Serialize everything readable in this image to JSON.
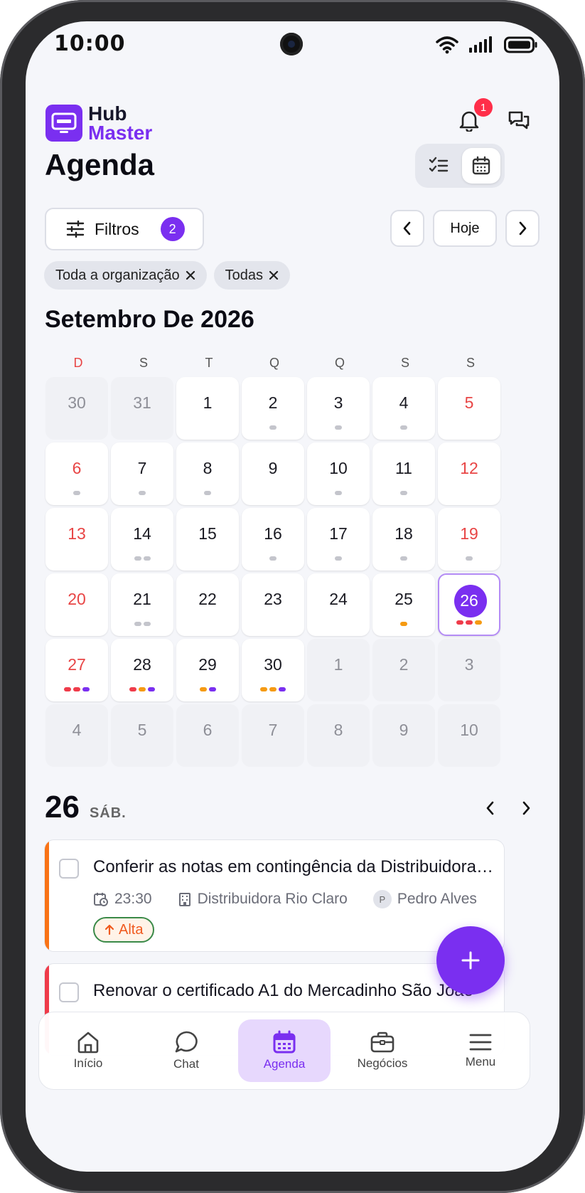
{
  "status_bar": {
    "time": "10:00"
  },
  "app": {
    "logo_line1": "Hub",
    "logo_line2": "Master",
    "notifications_count": "1"
  },
  "page": {
    "title": "Agenda"
  },
  "filters": {
    "label": "Filtros",
    "count": "2",
    "today": "Hoje"
  },
  "chips": [
    {
      "label": "Toda a organização"
    },
    {
      "label": "Todas"
    }
  ],
  "calendar": {
    "month_title": "Setembro De 2026",
    "weekdays": [
      "D",
      "S",
      "T",
      "Q",
      "Q",
      "S",
      "S"
    ],
    "colors": {
      "gray": "#c4c5cc",
      "red": "#ef3b4a",
      "orange": "#f59a12",
      "purple": "#7a2ff0"
    },
    "days": [
      {
        "n": "30",
        "out": true,
        "dots": []
      },
      {
        "n": "31",
        "out": true,
        "dots": []
      },
      {
        "n": "1",
        "dots": []
      },
      {
        "n": "2",
        "dots": [
          "gray"
        ]
      },
      {
        "n": "3",
        "dots": [
          "gray"
        ]
      },
      {
        "n": "4",
        "dots": [
          "gray"
        ]
      },
      {
        "n": "5",
        "weekend": true,
        "dots": []
      },
      {
        "n": "6",
        "weekend": true,
        "dots": [
          "gray"
        ]
      },
      {
        "n": "7",
        "dots": [
          "gray"
        ]
      },
      {
        "n": "8",
        "dots": [
          "gray"
        ]
      },
      {
        "n": "9",
        "dots": []
      },
      {
        "n": "10",
        "dots": [
          "gray"
        ]
      },
      {
        "n": "11",
        "dots": [
          "gray"
        ]
      },
      {
        "n": "12",
        "weekend": true,
        "dots": []
      },
      {
        "n": "13",
        "weekend": true,
        "dots": []
      },
      {
        "n": "14",
        "dots": [
          "gray",
          "gray"
        ]
      },
      {
        "n": "15",
        "dots": []
      },
      {
        "n": "16",
        "dots": [
          "gray"
        ]
      },
      {
        "n": "17",
        "dots": [
          "gray"
        ]
      },
      {
        "n": "18",
        "dots": [
          "gray"
        ]
      },
      {
        "n": "19",
        "weekend": true,
        "dots": [
          "gray"
        ]
      },
      {
        "n": "20",
        "weekend": true,
        "dots": []
      },
      {
        "n": "21",
        "dots": [
          "gray",
          "gray"
        ]
      },
      {
        "n": "22",
        "dots": []
      },
      {
        "n": "23",
        "dots": []
      },
      {
        "n": "24",
        "dots": []
      },
      {
        "n": "25",
        "dots": [
          "orange"
        ]
      },
      {
        "n": "26",
        "selected": true,
        "dots": [
          "red",
          "red",
          "orange"
        ]
      },
      {
        "n": "27",
        "weekend": true,
        "dots": [
          "red",
          "red",
          "purple"
        ]
      },
      {
        "n": "28",
        "dots": [
          "red",
          "orange",
          "purple"
        ]
      },
      {
        "n": "29",
        "dots": [
          "orange",
          "purple"
        ]
      },
      {
        "n": "30",
        "dots": [
          "orange",
          "orange",
          "purple"
        ]
      },
      {
        "n": "1",
        "out": true,
        "dots": []
      },
      {
        "n": "2",
        "out": true,
        "dots": []
      },
      {
        "n": "3",
        "out": true,
        "dots": []
      },
      {
        "n": "4",
        "out": true,
        "dots": []
      },
      {
        "n": "5",
        "out": true,
        "dots": []
      },
      {
        "n": "6",
        "out": true,
        "dots": []
      },
      {
        "n": "7",
        "out": true,
        "dots": []
      },
      {
        "n": "8",
        "out": true,
        "dots": []
      },
      {
        "n": "9",
        "out": true,
        "dots": []
      },
      {
        "n": "10",
        "out": true,
        "dots": []
      }
    ]
  },
  "selected_day": {
    "number": "26",
    "weekday": "SÁB."
  },
  "tasks": [
    {
      "title": "Conferir as notas em contingência da Distribuidora Rio Claro",
      "time": "23:30",
      "company": "Distribuidora Rio Claro",
      "assignee_initial": "P",
      "assignee": "Pedro Alves",
      "priority": "Alta",
      "accent": "#f97316"
    },
    {
      "title": "Renovar o certificado A1 do Mercadinho São João",
      "accent": "#ef3b4a"
    }
  ],
  "bottom_nav": [
    {
      "label": "Início",
      "icon": "home-icon"
    },
    {
      "label": "Chat",
      "icon": "chat-icon"
    },
    {
      "label": "Agenda",
      "icon": "calendar-icon",
      "active": true
    },
    {
      "label": "Negócios",
      "icon": "briefcase-icon"
    },
    {
      "label": "Menu",
      "icon": "menu-icon"
    }
  ]
}
